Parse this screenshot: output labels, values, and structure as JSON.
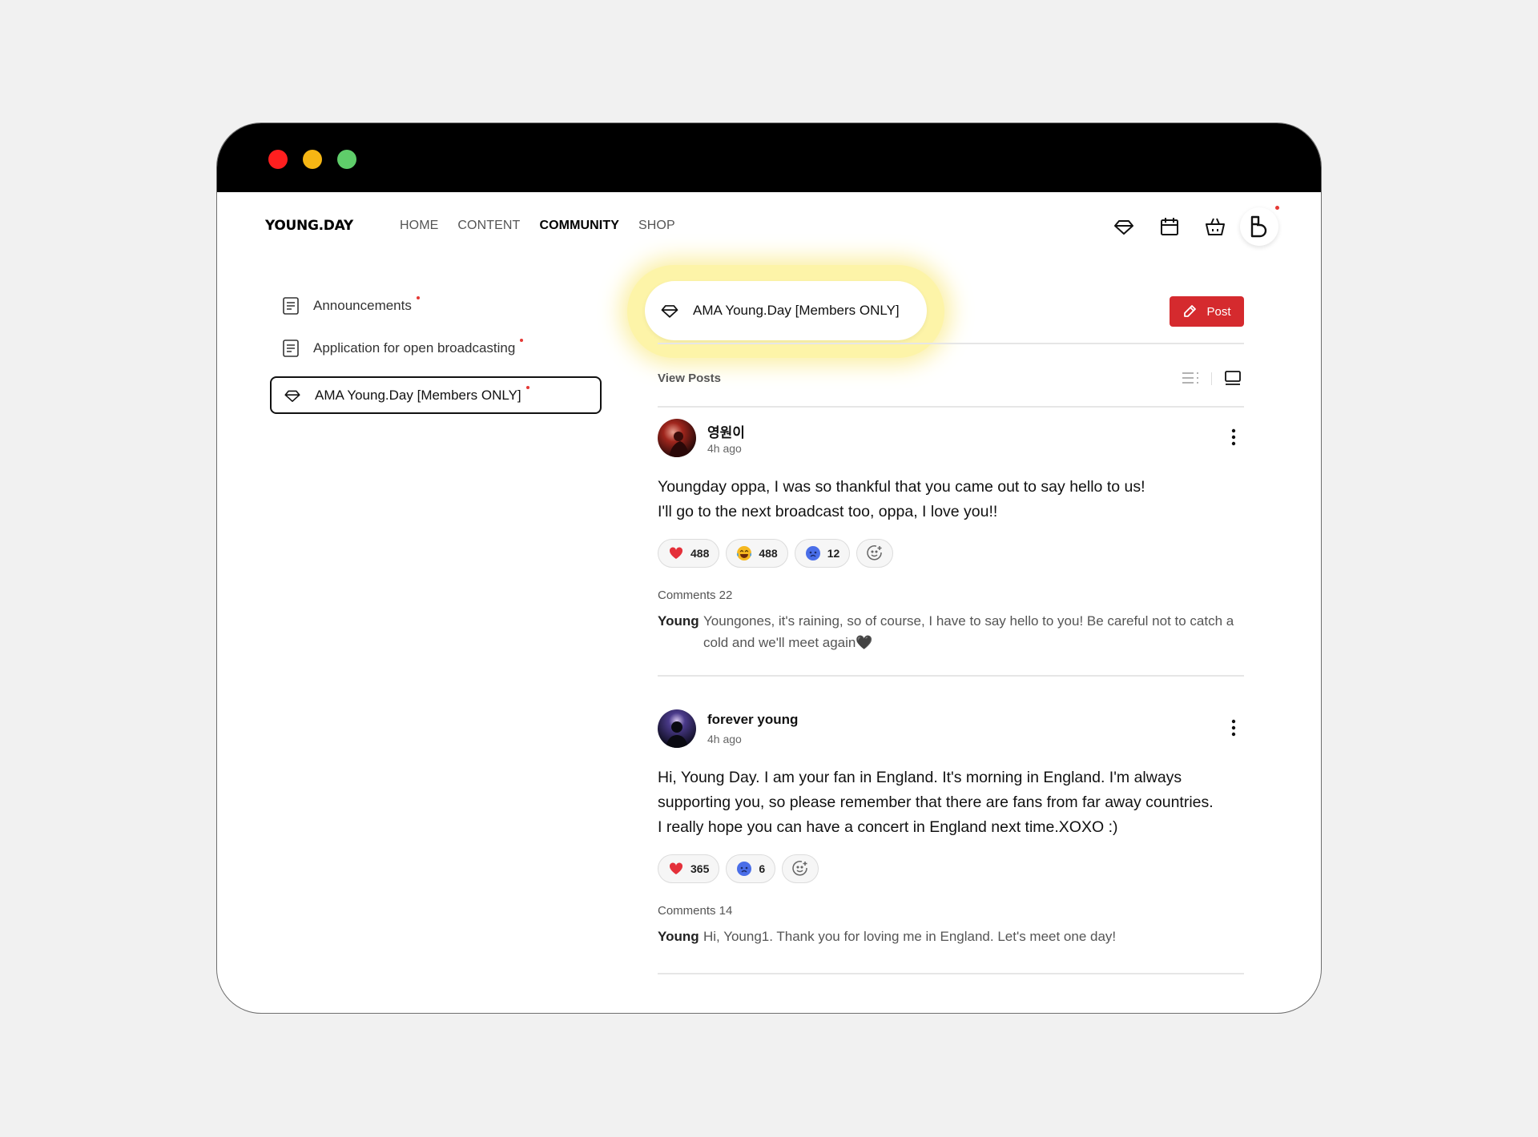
{
  "header": {
    "logo": "YOUNG.DAY",
    "nav": [
      {
        "label": "HOME",
        "active": false
      },
      {
        "label": "CONTENT",
        "active": false
      },
      {
        "label": "COMMUNITY",
        "active": true
      },
      {
        "label": "SHOP",
        "active": false
      }
    ],
    "icons": [
      "diamond-icon",
      "calendar-icon",
      "shopping-bag-icon",
      "profile-logo-icon"
    ]
  },
  "sidebar": {
    "items": [
      {
        "label": "Announcements",
        "icon": "document-icon",
        "selected": false,
        "new": true
      },
      {
        "label": "Application for open broadcasting",
        "icon": "document-icon",
        "selected": false,
        "new": true
      },
      {
        "label": "AMA Young.Day [Members ONLY]",
        "icon": "diamond-icon",
        "selected": true,
        "new": true
      }
    ]
  },
  "main": {
    "channel_title": "AMA Young.Day [Members ONLY]",
    "post_button": "Post",
    "view_posts_label": "View Posts",
    "posts": [
      {
        "author": "영원이",
        "time": "4h ago",
        "body_lines": [
          "Youngday oppa, I was so thankful that you came out to say hello to us!",
          "I'll go to the next broadcast too, oppa, I love you!!"
        ],
        "reactions": [
          {
            "emoji": "heart",
            "count": "488"
          },
          {
            "emoji": "laughing",
            "count": "488"
          },
          {
            "emoji": "blue-face",
            "count": "12"
          }
        ],
        "comments_label": "Comments 22",
        "comment": {
          "author": "Young",
          "text": "Youngones, it's raining, so of course, I have to say hello to you! Be careful not to catch a cold and we'll meet again🖤"
        }
      },
      {
        "author": "forever young",
        "time": "4h ago",
        "body_lines": [
          "Hi, Young Day. I am your fan in England. It's morning in England. I'm always",
          "supporting you, so please remember that there are fans from far away countries.",
          "I really hope you can have a concert in England next time.XOXO :)"
        ],
        "reactions": [
          {
            "emoji": "heart",
            "count": "365"
          },
          {
            "emoji": "blue-face",
            "count": "6"
          }
        ],
        "comments_label": "Comments 14",
        "comment": {
          "author": "Young",
          "text": "Hi, Young1.  Thank you for loving me in England. Let's meet one day!"
        }
      }
    ]
  },
  "colors": {
    "accent_red": "#d52a2e",
    "highlight_yellow": "#fdf4a8",
    "titlebar": "#000000"
  }
}
